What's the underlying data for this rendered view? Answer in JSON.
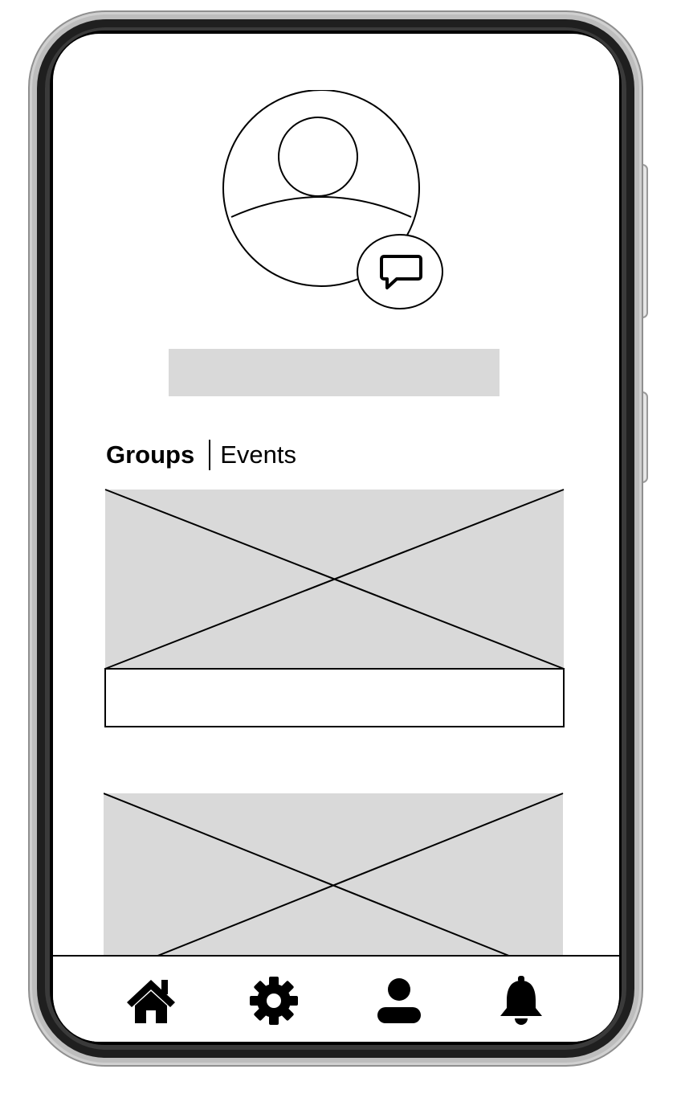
{
  "tabs": {
    "active": "Groups",
    "inactive": "Events"
  },
  "profile": {
    "avatar_icon": "user-avatar-icon",
    "message_icon": "chat-bubble-icon"
  },
  "bottom_nav": [
    {
      "icon": "home-icon"
    },
    {
      "icon": "gear-icon"
    },
    {
      "icon": "person-icon"
    },
    {
      "icon": "bell-icon"
    }
  ],
  "colors": {
    "placeholder_fill": "#d9d9d9",
    "frame_dark": "#1a1a1a",
    "frame_light": "#c8c8c8"
  }
}
